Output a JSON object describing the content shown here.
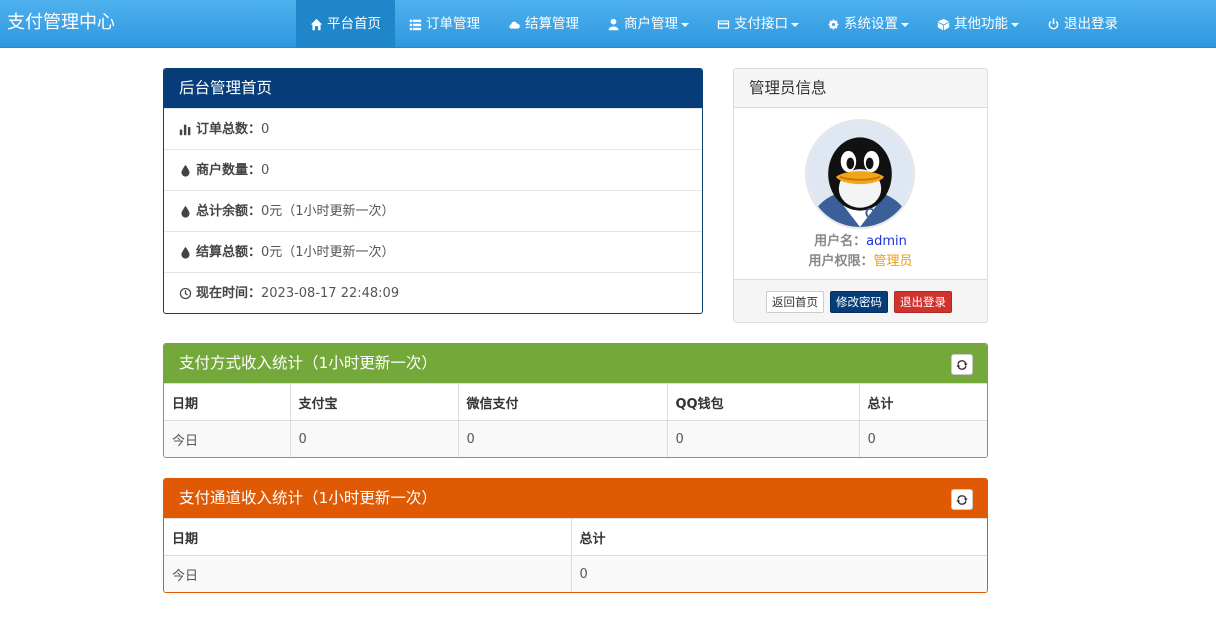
{
  "brand": "支付管理中心",
  "nav": [
    {
      "label": "平台首页",
      "icon": "home-icon",
      "active": true
    },
    {
      "label": "订单管理",
      "icon": "list-icon"
    },
    {
      "label": "结算管理",
      "icon": "cloud-icon"
    },
    {
      "label": "商户管理",
      "icon": "user-icon",
      "dropdown": true
    },
    {
      "label": "支付接口",
      "icon": "credit-card-icon",
      "dropdown": true
    },
    {
      "label": "系统设置",
      "icon": "gear-icon",
      "dropdown": true
    },
    {
      "label": "其他功能",
      "icon": "cube-icon",
      "dropdown": true
    },
    {
      "label": "退出登录",
      "icon": "power-icon"
    }
  ],
  "home": {
    "title": "后台管理首页",
    "rows": [
      {
        "icon": "bar-chart-icon",
        "label": "订单总数：",
        "value": "0"
      },
      {
        "icon": "tint-icon",
        "label": "商户数量：",
        "value": "0"
      },
      {
        "icon": "tint-icon",
        "label": "总计余额：",
        "value": "0元（1小时更新一次）"
      },
      {
        "icon": "tint-icon",
        "label": "结算总额：",
        "value": "0元（1小时更新一次）"
      },
      {
        "icon": "clock-icon",
        "label": "现在时间：",
        "value": " 2023-08-17 22:48:09"
      }
    ]
  },
  "admin": {
    "title": "管理员信息",
    "username_label": "用户名：",
    "username": "admin",
    "role_label": "用户权限：",
    "role": "管理员",
    "btn_home": "返回首页",
    "btn_password": "修改密码",
    "btn_logout": "退出登录"
  },
  "payment_stats": {
    "title": "支付方式收入统计（1小时更新一次）",
    "headers": [
      "日期",
      "支付宝",
      "微信支付",
      "QQ钱包",
      "总计"
    ],
    "rows": [
      [
        "今日",
        "0",
        "0",
        "0",
        "0"
      ]
    ]
  },
  "channel_stats": {
    "title": "支付通道收入统计（1小时更新一次）",
    "headers": [
      "日期",
      "总计"
    ],
    "rows": [
      [
        "今日",
        "0"
      ]
    ]
  }
}
